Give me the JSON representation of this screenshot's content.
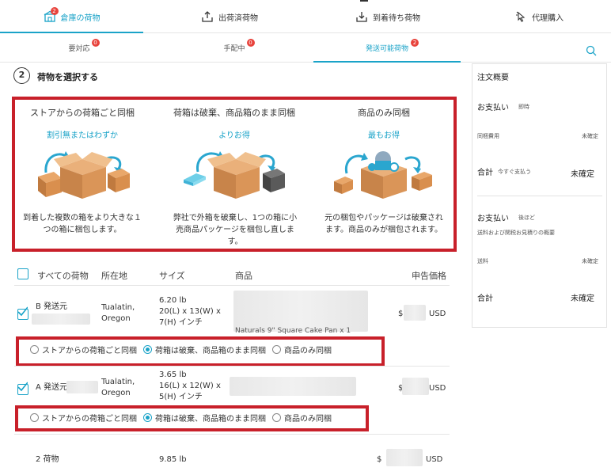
{
  "top_tabs": [
    {
      "label": "倉庫の荷物",
      "badge": "2",
      "icon": "warehouse-icon"
    },
    {
      "label": "出荷済荷物",
      "icon": "upload-box-icon"
    },
    {
      "label": "到着待ち荷物",
      "icon": "download-box-icon"
    },
    {
      "label": "代理購入",
      "icon": "cursor-click-icon"
    }
  ],
  "sub_tabs": [
    {
      "label": "要対応",
      "badge": "0"
    },
    {
      "label": "手配中",
      "badge": "0"
    },
    {
      "label": "発送可能荷物",
      "badge": "2"
    }
  ],
  "step": {
    "number": "2",
    "title": "荷物を選択する"
  },
  "options": [
    {
      "title": "ストアからの荷箱ごと同梱",
      "subtitle": "割引無またはわずか",
      "desc_line1": "到着した複数の箱をより大きな１",
      "desc_line2": "つの箱に梱包します。",
      "desc_line3": ""
    },
    {
      "title": "荷箱は破棄、商品箱のまま同梱",
      "subtitle": "よりお得",
      "desc_line1": "弊社で外箱を破棄し、1つの箱に小",
      "desc_line2": "売商品パッケージを梱包し直しま",
      "desc_line3": "す。"
    },
    {
      "title": "商品のみ同梱",
      "subtitle": "最もお得",
      "desc_line1": "元の梱包やパッケージは破棄され",
      "desc_line2": "ます。商品のみが梱包されます。",
      "desc_line3": ""
    }
  ],
  "table": {
    "headers": {
      "all": "すべての荷物",
      "location": "所在地",
      "size": "サイズ",
      "product": "商品",
      "price": "申告価格"
    },
    "rows": [
      {
        "prefix": "B 発送元",
        "location_line1": "Tualatin,",
        "location_line2": "Oregon",
        "size_line1": "6.20 lb",
        "size_line2": "20(L) x 13(W) x",
        "size_line3": "7(H) インチ",
        "product_fragment": "Naturals 9\" Square Cake Pan x 1",
        "currency_prefix": "$",
        "currency": "USD"
      },
      {
        "prefix": "A 発送元",
        "location_line1": "Tualatin,",
        "location_line2": "Oregon",
        "size_line1": "3.65 lb",
        "size_line2": "16(L) x 12(W) x",
        "size_line3": "5(H) インチ",
        "product_fragment": "",
        "currency_prefix": "$",
        "currency": "USD"
      }
    ],
    "radio_options": [
      "ストアからの荷箱ごと同梱",
      "荷箱は破棄、商品箱のまま同梱",
      "商品のみ同梱"
    ],
    "total": {
      "count": "2 荷物",
      "weight": "9.85 lb",
      "currency_prefix": "$",
      "currency": "USD"
    }
  },
  "summary": {
    "title": "注文概要",
    "pay_now_label": "お支払い",
    "pay_now_tag": "即時",
    "shipping_fee_label": "同梱費用",
    "shipping_fee_value": "未確定",
    "subtotal_label": "合計",
    "subtotal_tag": "今すぐ支払う",
    "subtotal_value": "未確定",
    "pay_later_label": "お支払い",
    "pay_later_tag": "後ほど",
    "pay_later_note": "送料および関税お見積りの概要",
    "postage_label": "送料",
    "postage_value": "未確定",
    "total_label": "合計",
    "total_value": "未確定"
  },
  "colors": {
    "accent": "#1aa3c8",
    "highlight_red": "#c8202a",
    "badge_red": "#e8433c"
  }
}
